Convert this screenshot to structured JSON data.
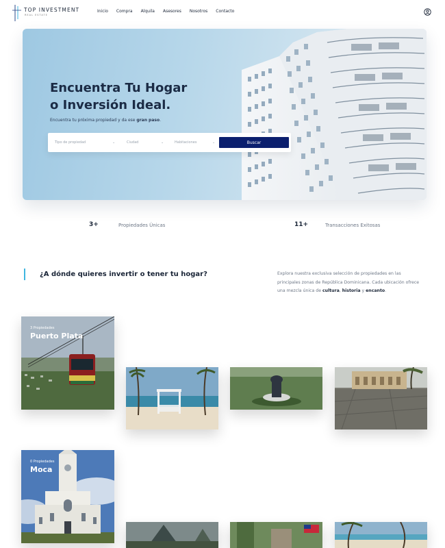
{
  "header": {
    "logo_title": "TOP INVESTMENT",
    "logo_subtitle": "REAL ESTATE",
    "nav": [
      "Inicio",
      "Compra",
      "Alquila",
      "Asesores",
      "Nosotros",
      "Contacto"
    ],
    "user_icon": "user-circle-icon"
  },
  "hero": {
    "title_line1": "Encuentra Tu Hogar",
    "title_line2": "o Inversión Ideal.",
    "subtitle_pre": "Encuentra tu próxima propiedad y da ese ",
    "subtitle_bold": "gran paso",
    "subtitle_post": ".",
    "search": {
      "type_placeholder": "Tipo de propiedad",
      "city_placeholder": "Ciudad",
      "rooms_placeholder": "Habitaciones",
      "button": "Buscar"
    }
  },
  "stats": [
    {
      "value": "3+",
      "label": "Propiedades Únicas"
    },
    {
      "value": "11+",
      "label": "Transacciones Exitosas"
    }
  ],
  "locations_section": {
    "title": "¿A dónde quieres invertir o tener tu hogar?",
    "desc_pre": "Explora nuestra exclusiva selección de propiedades en las principales zonas de República Dominicana. Cada ubicación ofrece una mezcla única de ",
    "desc_b1": "cultura",
    "desc_mid": ", ",
    "desc_b2": "historia",
    "desc_mid2": " y ",
    "desc_b3": "encanto",
    "desc_post": "."
  },
  "locations": [
    {
      "count": "3 Propiedades",
      "name": "Puerto Plata"
    },
    {
      "count": "0 Propiedades",
      "name": "Moca"
    }
  ],
  "colors": {
    "accent": "#3fb6e0",
    "button": "#0b1f6e",
    "heading": "#1a2537"
  }
}
